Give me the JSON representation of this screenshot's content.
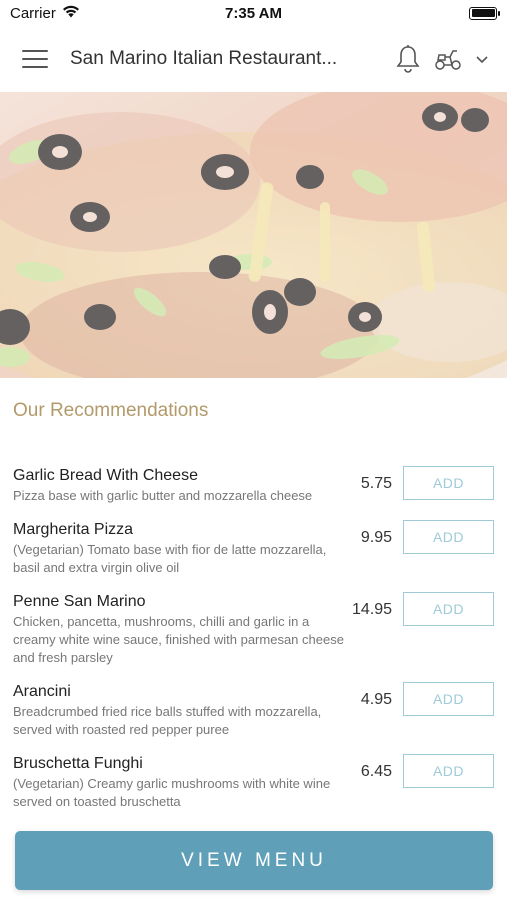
{
  "status_bar": {
    "carrier": "Carrier",
    "time": "7:35 AM"
  },
  "header": {
    "title": "San Marino Italian Restaurant...",
    "icons": [
      "hamburger-menu-icon",
      "bell-icon",
      "delivery-scooter-icon",
      "chevron-down-icon"
    ]
  },
  "recommendations": {
    "title": "Our Recommendations",
    "items": [
      {
        "name": "Garlic Bread With Cheese",
        "description": "Pizza base with garlic butter and mozzarella cheese",
        "price": "5.75",
        "add_label": "ADD"
      },
      {
        "name": "Margherita Pizza",
        "description": "(Vegetarian) Tomato base with fior de latte mozzarella, basil and extra virgin olive oil",
        "price": "9.95",
        "add_label": "ADD"
      },
      {
        "name": "Penne San Marino",
        "description": "Chicken, pancetta, mushrooms, chilli and garlic in a creamy white wine sauce, finished with parmesan cheese and fresh parsley",
        "price": "14.95",
        "add_label": "ADD"
      },
      {
        "name": "Arancini",
        "description": "Breadcrumbed fried rice balls stuffed with mozzarella, served with roasted red pepper puree",
        "price": "4.95",
        "add_label": "ADD"
      },
      {
        "name": "Bruschetta Funghi",
        "description": "(Vegetarian) Creamy garlic mushrooms with white wine served on toasted bruschetta",
        "price": "6.45",
        "add_label": "ADD"
      }
    ]
  },
  "footer": {
    "view_menu_label": "VIEW MENU"
  },
  "colors": {
    "accent": "#5fa0b8",
    "add_border": "#9fcad8",
    "section_title": "#b29a6a"
  }
}
